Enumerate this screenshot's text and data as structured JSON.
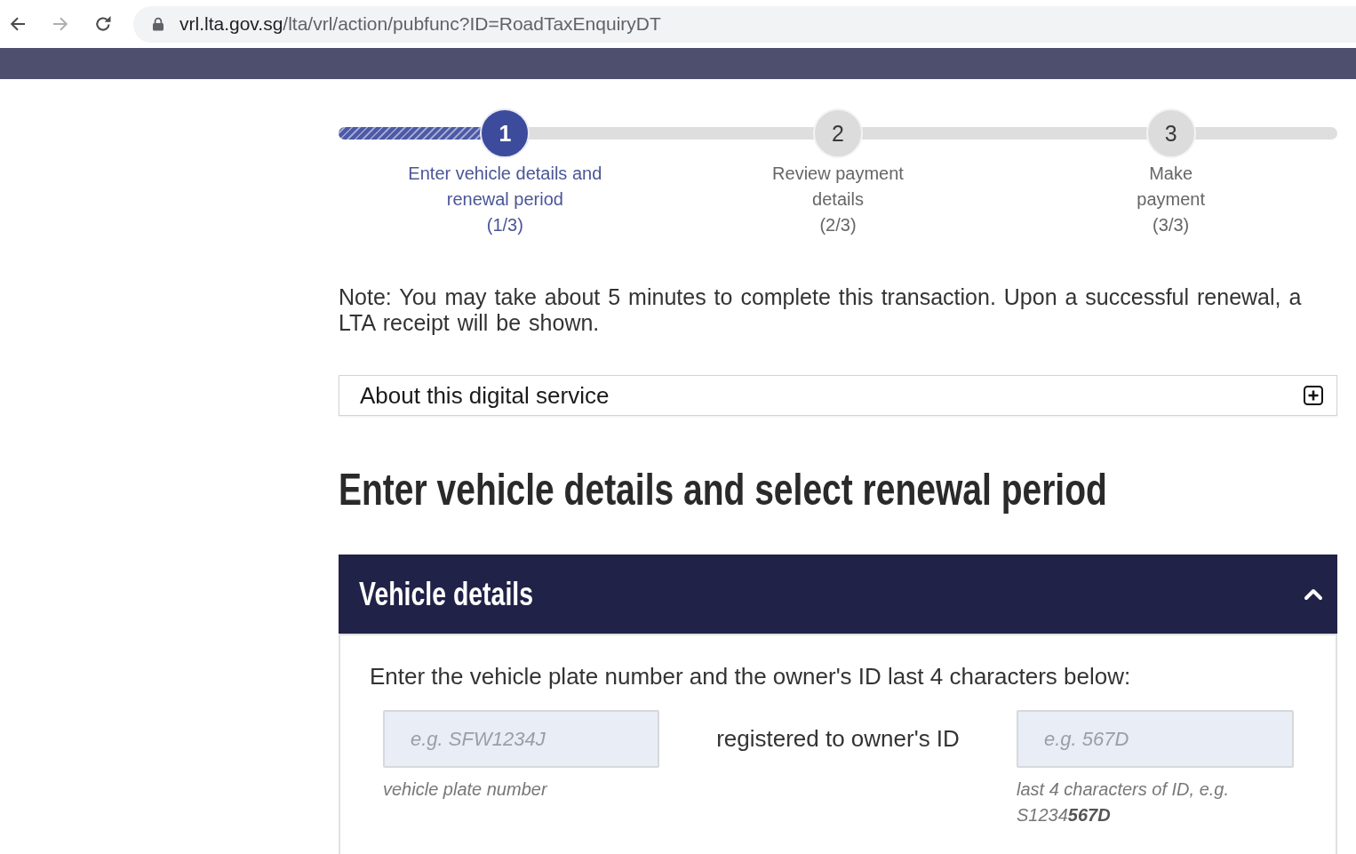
{
  "browser": {
    "nav": [
      {
        "kind": "back",
        "disabled": false
      },
      {
        "kind": "forward",
        "disabled": true
      },
      {
        "kind": "reload",
        "disabled": false
      }
    ],
    "url": {
      "host": "vrl.lta.gov.sg",
      "path": "/lta/vrl/action/pubfunc?ID=RoadTaxEnquiryDT"
    }
  },
  "steps": [
    {
      "number": "1",
      "label": [
        "Enter vehicle details and",
        "renewal period"
      ],
      "counter": "(1/3)",
      "selected": true
    },
    {
      "number": "2",
      "label": [
        "Review payment",
        "details"
      ],
      "counter": "(2/3)",
      "selected": false
    },
    {
      "number": "3",
      "label": [
        "Make",
        "payment"
      ],
      "counter": "(3/3)",
      "selected": false
    }
  ],
  "note": "Note: You may take about 5 minutes to complete this transaction. Upon a successful renewal, a LTA receipt will be shown.",
  "about_section": {
    "title": "About this digital service",
    "expanded": false
  },
  "heading": "Enter vehicle details and select renewal period",
  "vehicle_section": {
    "title": "Vehicle details",
    "expanded": true,
    "instruction": "Enter the vehicle plate number and the owner's ID last 4 characters below:",
    "plate_field": {
      "placeholder": "e.g. SFW1234J",
      "hint": "vehicle plate number"
    },
    "connector": "registered to owner's ID",
    "id_field": {
      "placeholder": "e.g. 567D",
      "hint": "last 4 characters of ID, e.g. S1234**567D**"
    }
  }
}
